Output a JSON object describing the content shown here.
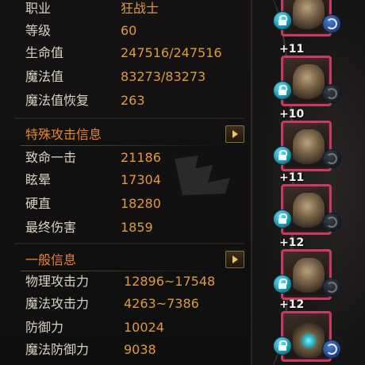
{
  "profile": {
    "job_label": "职业",
    "job_value": "狂战士",
    "level_label": "等级",
    "level_value": "60",
    "hp_label": "生命值",
    "hp_value": "247516/247516",
    "mp_label": "魔法值",
    "mp_value": "83273/83273",
    "mp_regen_label": "魔法值恢复",
    "mp_regen_value": "263"
  },
  "special_attack": {
    "title": "特殊攻击信息",
    "rows": [
      {
        "label": "致命一击",
        "value": "21186"
      },
      {
        "label": "眩晕",
        "value": "17304"
      },
      {
        "label": "硬直",
        "value": "18280"
      },
      {
        "label": "最终伤害",
        "value": "1859"
      }
    ]
  },
  "general": {
    "title": "一般信息",
    "rows": [
      {
        "label": "物理攻击力",
        "value": "12896~17548"
      },
      {
        "label": "魔法攻击力",
        "value": "4263~7386"
      },
      {
        "label": "防御力",
        "value": "10024"
      },
      {
        "label": "魔法防御力",
        "value": "9038"
      }
    ]
  },
  "equipment": {
    "slots": [
      {
        "level": "",
        "swap": "active"
      },
      {
        "level": "+11",
        "swap": "dim"
      },
      {
        "level": "+10",
        "swap": "dim"
      },
      {
        "level": "+11",
        "swap": "dim"
      },
      {
        "level": "+12",
        "swap": "dim"
      },
      {
        "level": "+12",
        "swap": "active"
      }
    ]
  },
  "colors": {
    "label": "#d9d2c4",
    "value": "#e0993e",
    "section_title": "#e8842d",
    "slot_frame": "#c23c63",
    "lock_icon": "#1b8ea6"
  },
  "icons": {
    "expand": "chevron-right-icon",
    "lock": "lock-icon",
    "swap": "swap-icon"
  }
}
